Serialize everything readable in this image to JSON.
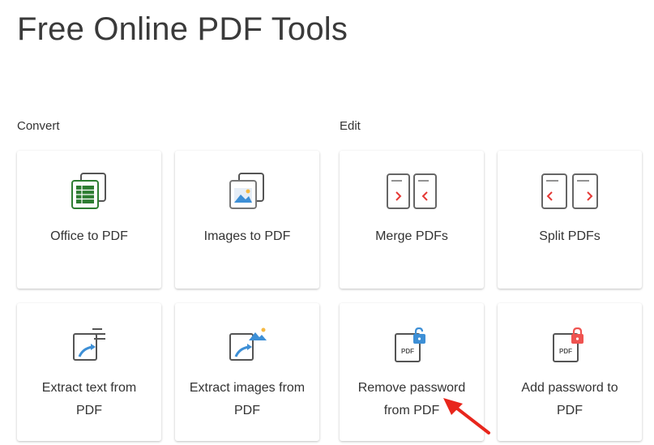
{
  "page": {
    "title": "Free Online PDF Tools"
  },
  "sections": {
    "convert": "Convert",
    "edit": "Edit"
  },
  "tools": {
    "office_to_pdf": {
      "label": "Office to PDF",
      "icon": "spreadsheet-icon"
    },
    "images_to_pdf": {
      "label": "Images to PDF",
      "icon": "image-icon"
    },
    "merge_pdfs": {
      "label": "Merge PDFs",
      "icon": "merge-icon"
    },
    "split_pdfs": {
      "label": "Split PDFs",
      "icon": "split-icon"
    },
    "extract_text": {
      "label_line1": "Extract text from",
      "label_line2": "PDF",
      "icon": "extract-text-icon"
    },
    "extract_images": {
      "label_line1": "Extract images from",
      "label_line2": "PDF",
      "icon": "extract-images-icon"
    },
    "remove_password": {
      "label_line1": "Remove password",
      "label_line2": "from PDF",
      "icon": "unlock-pdf-icon",
      "badge": "PDF"
    },
    "add_password": {
      "label_line1": "Add password to",
      "label_line2": "PDF",
      "icon": "lock-pdf-icon",
      "badge": "PDF"
    }
  },
  "colors": {
    "spreadsheet_green": "#2e7d32",
    "merge_split_red": "#e53935",
    "image_blue": "#3d8fd6",
    "unlock_blue": "#3d8fd6",
    "lock_red": "#ef5350",
    "annotation_arrow": "#e8261c"
  }
}
